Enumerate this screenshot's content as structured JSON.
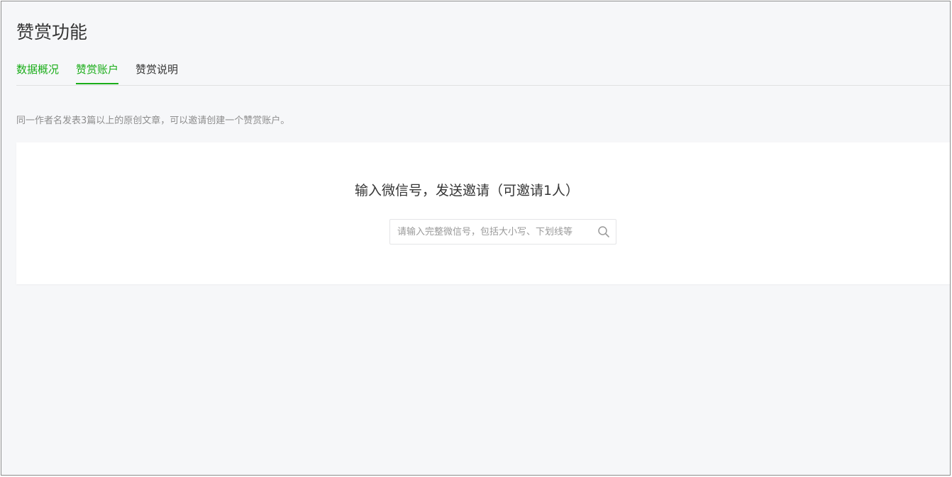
{
  "page": {
    "title": "赞赏功能"
  },
  "tabs": [
    {
      "label": "数据概况"
    },
    {
      "label": "赞赏账户"
    },
    {
      "label": "赞赏说明"
    }
  ],
  "tip": "同一作者名发表3篇以上的原创文章，可以邀请创建一个赞赏账户。",
  "invite": {
    "heading": "输入微信号，发送邀请（可邀请1人）",
    "search_placeholder": "请输入完整微信号，包括大小写、下划线等",
    "search_value": "",
    "search_icon": "search-icon"
  },
  "colors": {
    "accent": "#1aad19",
    "background": "#f6f7f9",
    "text": "#353535",
    "muted": "#8d8d8d"
  }
}
